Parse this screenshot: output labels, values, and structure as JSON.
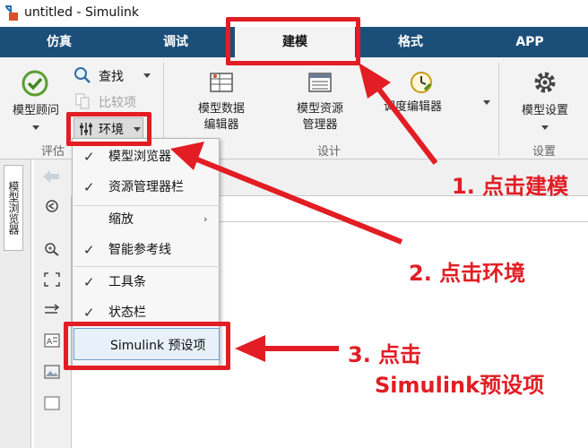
{
  "window": {
    "title": "untitled - Simulink"
  },
  "tabs": [
    "仿真",
    "调试",
    "建模",
    "格式",
    "APP"
  ],
  "active_tab": "建模",
  "ribbon": {
    "model_advisor": "模型顾问",
    "find": "查找",
    "compare": "比较项",
    "environment": "环境",
    "model_data_editor": [
      "模型数据",
      "编辑器"
    ],
    "model_explorer": [
      "模型资源",
      "管理器"
    ],
    "schedule_editor": "调度编辑器",
    "model_settings": "模型设置",
    "groups": {
      "evaluate": "评估",
      "design": "设计",
      "setup": "设置"
    }
  },
  "side_tab": "模型浏览器",
  "menu": {
    "items": [
      {
        "label": "模型浏览器",
        "checked": true
      },
      {
        "label": "资源管理器栏",
        "checked": true
      },
      {
        "label": "缩放",
        "checked": false,
        "submenu": true
      },
      {
        "label": "智能参考线",
        "checked": true
      },
      {
        "label": "工具条",
        "checked": true
      },
      {
        "label": "状态栏",
        "checked": true
      }
    ],
    "preferences": "Simulink 预设项",
    "check_glyph": "✓",
    "submenu_glyph": "›"
  },
  "annotations": {
    "step1": "1. 点击建模",
    "step2": "2. 点击环境",
    "step3_line1": "3. 点击",
    "step3_line2": "Simulink预设项",
    "color": "#e21d24"
  },
  "colors": {
    "tabbar": "#1b4f7a",
    "ribbon": "#f3f3f3",
    "accent_red": "#e21d24"
  },
  "icons": [
    "simulink-logo-icon",
    "checkmark-icon",
    "search-icon",
    "compare-icon",
    "environment-icon",
    "model-data-editor-icon",
    "model-explorer-icon",
    "schedule-editor-icon",
    "gear-icon",
    "back-arrow-icon",
    "zoom-icon",
    "fit-icon",
    "arrow-icon",
    "text-icon",
    "image-icon",
    "box-icon"
  ]
}
